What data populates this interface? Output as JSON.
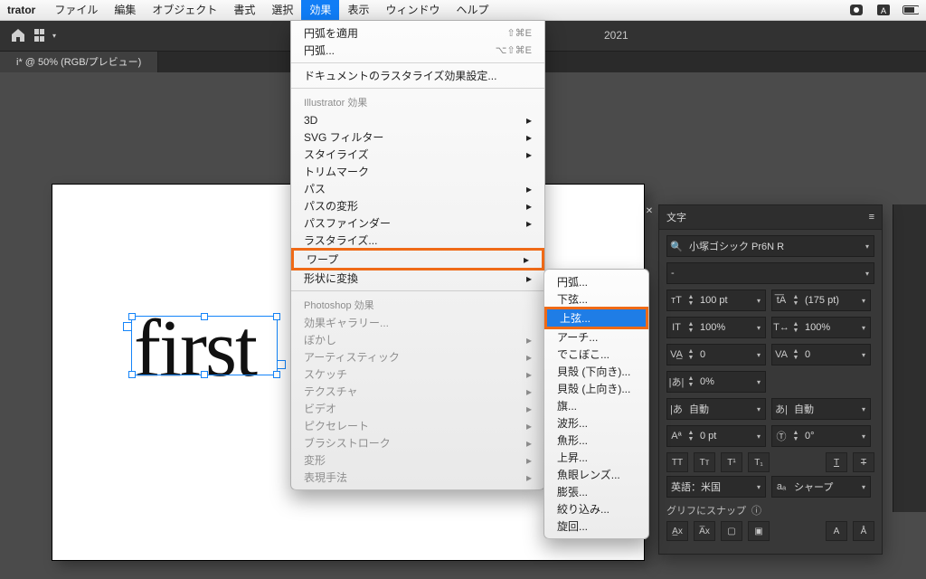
{
  "menubar": {
    "app": "trator",
    "items": [
      "ファイル",
      "編集",
      "オブジェクト",
      "書式",
      "選択",
      "効果",
      "表示",
      "ウィンドウ",
      "ヘルプ"
    ],
    "active_index": 5
  },
  "app_strip": {
    "version": "2021"
  },
  "doc_tab": {
    "label": "i* @ 50% (RGB/プレビュー)"
  },
  "artboard": {
    "text": "first"
  },
  "effects_menu": {
    "recent_apply": {
      "label": "円弧を適用",
      "shortcut": "⇧⌘E"
    },
    "recent_options": {
      "label": "円弧...",
      "shortcut": "⌥⇧⌘E"
    },
    "doc_raster": {
      "label": "ドキュメントのラスタライズ効果設定..."
    },
    "hdr_ai": "Illustrator 効果",
    "ai": [
      {
        "label": "3D",
        "sub": true
      },
      {
        "label": "SVG フィルター",
        "sub": true
      },
      {
        "label": "スタイライズ",
        "sub": true
      },
      {
        "label": "トリムマーク",
        "sub": false
      },
      {
        "label": "パス",
        "sub": true
      },
      {
        "label": "パスの変形",
        "sub": true
      },
      {
        "label": "パスファインダー",
        "sub": true
      },
      {
        "label": "ラスタライズ...",
        "sub": false
      },
      {
        "label": "ワープ",
        "sub": true,
        "hl": true
      },
      {
        "label": "形状に変換",
        "sub": true
      }
    ],
    "hdr_ps": "Photoshop 効果",
    "ps": [
      {
        "label": "効果ギャラリー...",
        "sub": false,
        "dis": true
      },
      {
        "label": "ぼかし",
        "sub": true,
        "dis": true
      },
      {
        "label": "アーティスティック",
        "sub": true,
        "dis": true
      },
      {
        "label": "スケッチ",
        "sub": true,
        "dis": true
      },
      {
        "label": "テクスチャ",
        "sub": true,
        "dis": true
      },
      {
        "label": "ビデオ",
        "sub": true,
        "dis": true
      },
      {
        "label": "ピクセレート",
        "sub": true,
        "dis": true
      },
      {
        "label": "ブラシストローク",
        "sub": true,
        "dis": true
      },
      {
        "label": "変形",
        "sub": true,
        "dis": true
      },
      {
        "label": "表現手法",
        "sub": true,
        "dis": true
      }
    ]
  },
  "warp_submenu": {
    "items": [
      "円弧...",
      "下弦...",
      "上弦...",
      "アーチ...",
      "でこぼこ...",
      "貝殻 (下向き)...",
      "貝殻 (上向き)...",
      "旗...",
      "波形...",
      "魚形...",
      "上昇...",
      "魚眼レンズ...",
      "膨張...",
      "絞り込み...",
      "旋回..."
    ],
    "selected_index": 2
  },
  "char_panel": {
    "title": "文字",
    "font_family": "小塚ゴシック Pr6N R",
    "font_style": "-",
    "font_size": "100 pt",
    "leading": "(175 pt)",
    "v_scale": "100%",
    "h_scale": "100%",
    "kerning": "0",
    "tracking": "0",
    "tsume": "0%",
    "aki_left": "自動",
    "aki_right": "自動",
    "baseline": "0 pt",
    "rotation": "0°",
    "language": "英語：米国",
    "antialias": "シャープ",
    "glyph_snap": "グリフにスナップ"
  }
}
